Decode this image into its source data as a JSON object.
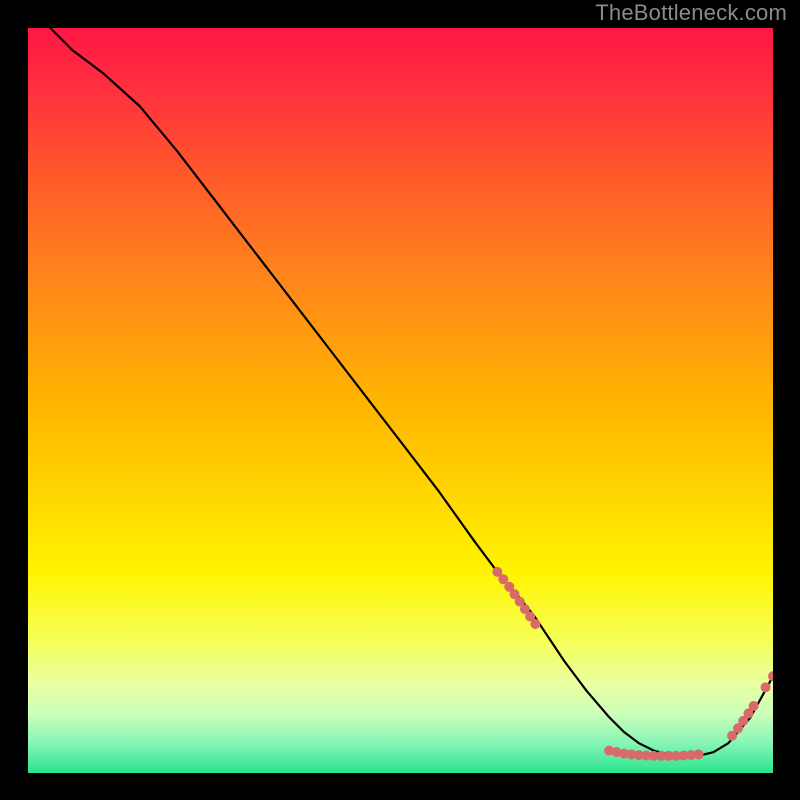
{
  "watermark": "TheBottleneck.com",
  "colors": {
    "background": "#000000",
    "line": "#000000",
    "marker": "#d86a6a",
    "gradient_stops": [
      {
        "offset": 0.0,
        "color": "#ff1744"
      },
      {
        "offset": 0.08,
        "color": "#ff2f3f"
      },
      {
        "offset": 0.2,
        "color": "#ff5a2a"
      },
      {
        "offset": 0.35,
        "color": "#ff8a1a"
      },
      {
        "offset": 0.5,
        "color": "#ffb400"
      },
      {
        "offset": 0.62,
        "color": "#ffd400"
      },
      {
        "offset": 0.73,
        "color": "#fff400"
      },
      {
        "offset": 0.82,
        "color": "#f6ff55"
      },
      {
        "offset": 0.88,
        "color": "#eaffa0"
      },
      {
        "offset": 0.92,
        "color": "#ccffba"
      },
      {
        "offset": 0.96,
        "color": "#86f5b6"
      },
      {
        "offset": 1.0,
        "color": "#29e38f"
      }
    ]
  },
  "chart_data": {
    "type": "line",
    "title": "",
    "xlabel": "",
    "ylabel": "",
    "xlim": [
      0,
      100
    ],
    "ylim": [
      0,
      100
    ],
    "grid": false,
    "legend": false,
    "series": [
      {
        "name": "curve",
        "x": [
          3,
          6,
          10,
          15,
          20,
          25,
          30,
          35,
          40,
          45,
          50,
          55,
          60,
          63,
          66,
          68,
          70,
          72,
          75,
          78,
          80,
          82,
          84,
          86,
          88,
          90,
          92,
          94,
          97,
          100
        ],
        "y": [
          100,
          97,
          94,
          89.5,
          83.5,
          77,
          70.5,
          64,
          57.5,
          51,
          44.5,
          38,
          31,
          27,
          23.5,
          21,
          18,
          15,
          11,
          7.5,
          5.5,
          4,
          3,
          2.5,
          2.3,
          2.3,
          2.8,
          4,
          7.5,
          13
        ],
        "show_markers": false
      }
    ],
    "markers": [
      {
        "x": 63.0,
        "y": 27.0
      },
      {
        "x": 63.8,
        "y": 26.0
      },
      {
        "x": 64.6,
        "y": 25.0
      },
      {
        "x": 65.3,
        "y": 24.0
      },
      {
        "x": 66.0,
        "y": 23.0
      },
      {
        "x": 66.7,
        "y": 22.0
      },
      {
        "x": 67.4,
        "y": 21.0
      },
      {
        "x": 68.1,
        "y": 20.0
      },
      {
        "x": 78.0,
        "y": 3.0
      },
      {
        "x": 79.0,
        "y": 2.8
      },
      {
        "x": 80.0,
        "y": 2.6
      },
      {
        "x": 81.0,
        "y": 2.5
      },
      {
        "x": 82.0,
        "y": 2.4
      },
      {
        "x": 83.0,
        "y": 2.35
      },
      {
        "x": 84.0,
        "y": 2.3
      },
      {
        "x": 85.0,
        "y": 2.3
      },
      {
        "x": 86.0,
        "y": 2.3
      },
      {
        "x": 87.0,
        "y": 2.3
      },
      {
        "x": 88.0,
        "y": 2.35
      },
      {
        "x": 89.0,
        "y": 2.4
      },
      {
        "x": 90.0,
        "y": 2.5
      },
      {
        "x": 94.5,
        "y": 5.0
      },
      {
        "x": 95.3,
        "y": 6.0
      },
      {
        "x": 96.0,
        "y": 7.0
      },
      {
        "x": 96.7,
        "y": 8.0
      },
      {
        "x": 97.4,
        "y": 9.0
      },
      {
        "x": 99.0,
        "y": 11.5
      },
      {
        "x": 100.0,
        "y": 13.0
      }
    ],
    "marker_radius_px": 5
  }
}
